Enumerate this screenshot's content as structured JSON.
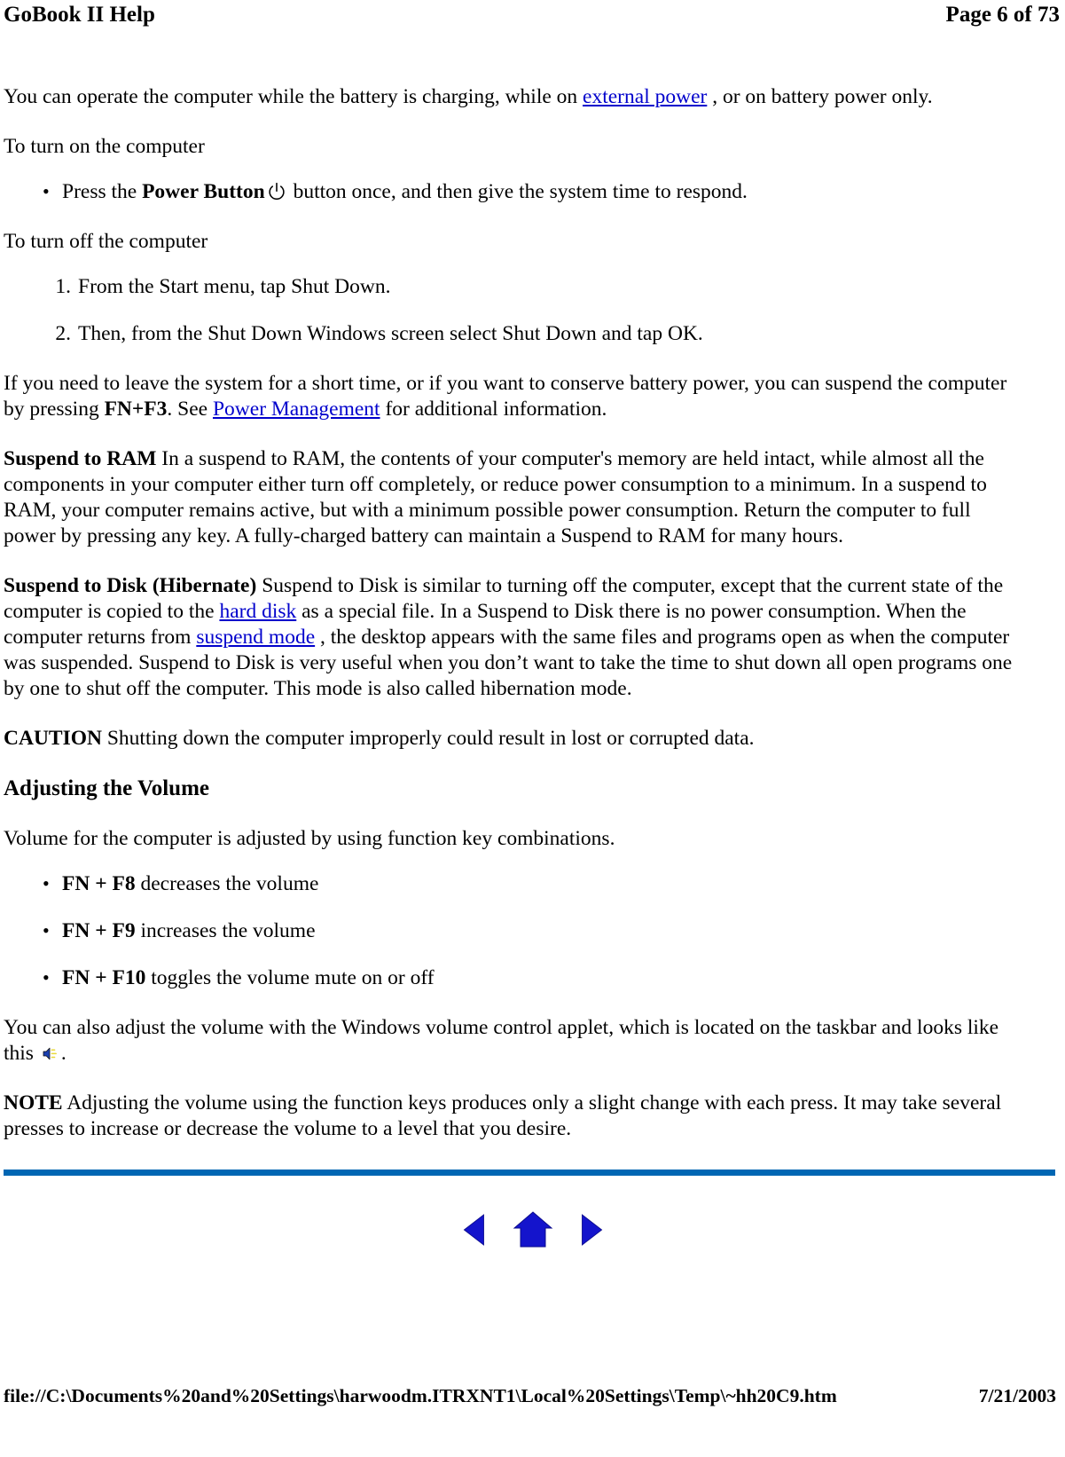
{
  "header": {
    "title": "GoBook II Help",
    "page_label": "Page 6 of 73"
  },
  "content": {
    "intro_before_link": "You can operate the computer while the battery is charging, while on ",
    "intro_link": "external power",
    "intro_after_link": " , or on battery power only.",
    "turn_on_heading": "To turn on the computer",
    "turn_on_bullet_before": "Press the ",
    "turn_on_bullet_bold": "Power Button",
    "turn_on_bullet_after": " button once, and then give the system time to respond.",
    "turn_off_heading": "To turn off the computer",
    "turn_off_steps": [
      "From the Start menu, tap Shut Down.",
      "Then, from the Shut Down Windows screen select Shut Down and tap OK."
    ],
    "suspend_intro_a": "If you need to leave the system for a short time, or if you want to conserve battery power, you can suspend the computer by pressing ",
    "suspend_intro_bold": "FN+F3",
    "suspend_intro_b": ".  See ",
    "suspend_intro_link": "Power Management",
    "suspend_intro_c": " for additional information.",
    "suspend_ram_label": "Suspend to RAM",
    "suspend_ram_text": "  In a suspend to RAM, the contents of your computer's memory are held intact, while almost all the components in your computer either turn off completely, or reduce power consumption to a minimum.  In a suspend to RAM, your computer remains active, but  with a minimum possible power consumption.  Return the computer to full power by pressing any key.  A fully-charged battery can maintain a Suspend to RAM for many hours.",
    "suspend_disk_label": "Suspend to Disk (Hibernate)",
    "suspend_disk_a": "  Suspend to Disk is similar to turning off the computer, except that the current state of the computer is copied to the ",
    "suspend_disk_link1": "hard disk",
    "suspend_disk_b": " as a special file.  In a Suspend to Disk there is no power consumption. When the computer returns from ",
    "suspend_disk_link2": "suspend mode",
    "suspend_disk_c": " , the desktop appears with the same files and programs open as when the computer was suspended.  Suspend to Disk is very useful when you don’t want to take the time to shut down all open programs one by one to shut off the computer.  This mode is also called hibernation mode.",
    "caution_label": "CAUTION",
    "caution_text": "  Shutting down the computer improperly could result in lost or corrupted data.",
    "volume_heading": "Adjusting the Volume",
    "volume_intro": "Volume for the computer is adjusted by using function key combinations.",
    "volume_bullets": [
      {
        "keys": "FN + F8",
        "text": " decreases the volume"
      },
      {
        "keys": "FN + F9",
        "text": " increases the volume"
      },
      {
        "keys": "FN + F10",
        "text": "  toggles the volume mute on or off"
      }
    ],
    "applet_text_a": "You can also adjust the volume with the Windows volume control applet, which is located on the taskbar and looks like this ",
    "applet_text_b": ".",
    "note_label": "NOTE",
    "note_text": "  Adjusting the volume using the function keys produces only a slight change with each press.  It may take several presses to increase or decrease the volume to a level that you desire."
  },
  "navigation": {
    "previous_label": "Previous page",
    "home_label": "Home",
    "next_label": "Next page"
  },
  "footer": {
    "file_path": "file://C:\\Documents%20and%20Settings\\harwoodm.ITRXNT1\\Local%20Settings\\Temp\\~hh20C9.htm",
    "date": "7/21/2003"
  },
  "colors": {
    "link": "#0000CC",
    "rule": "#0066B3",
    "nav_icon": "#1414CC"
  }
}
